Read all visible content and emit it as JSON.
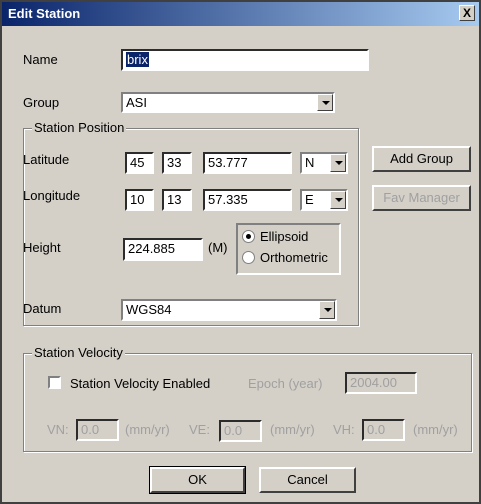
{
  "window": {
    "title": "Edit Station",
    "close_glyph": "X"
  },
  "name": {
    "label": "Name",
    "value": "brix"
  },
  "group": {
    "label": "Group",
    "value": "ASI"
  },
  "position": {
    "legend": "Station Position",
    "latitude_label": "Latitude",
    "lat_deg": "45",
    "lat_min": "33",
    "lat_sec": "53.777",
    "lat_hemi": "N",
    "longitude_label": "Longitude",
    "lon_deg": "10",
    "lon_min": "13",
    "lon_sec": "57.335",
    "lon_hemi": "E",
    "height_label": "Height",
    "height_value": "224.885",
    "height_unit": "(M)",
    "ellipsoid_label": "Ellipsoid",
    "orthometric_label": "Orthometric",
    "datum_label": "Datum",
    "datum_value": "WGS84"
  },
  "side_buttons": {
    "add_group": "Add Group",
    "fav_manager": "Fav Manager"
  },
  "velocity": {
    "legend": "Station Velocity",
    "enabled_label": "Station Velocity Enabled",
    "epoch_label": "Epoch (year)",
    "epoch_value": "2004.00",
    "vn_label": "VN:",
    "vn_value": "0.0",
    "ve_label": "VE:",
    "ve_value": "0.0",
    "vh_label": "VH:",
    "vh_value": "0.0",
    "unit": "(mm/yr)"
  },
  "footer": {
    "ok": "OK",
    "cancel": "Cancel"
  }
}
